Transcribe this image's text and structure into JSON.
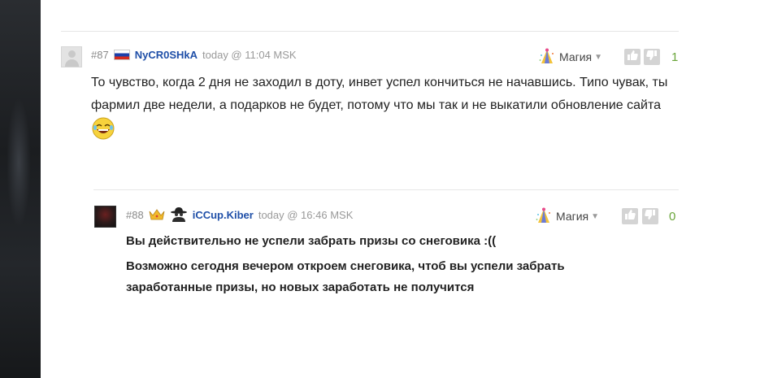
{
  "comments": [
    {
      "number": "#87",
      "username": "NyCR0SHkA",
      "time": "today @ 11:04 MSK",
      "badge_label": "Магия",
      "score": "1",
      "text": "То чувство, когда 2 дня не заходил в доту, инвет успел кончиться не начавшись. Типо чувак, ты фармил две недели, а подарков не будет, потому что мы так и не выкатили обновление сайта",
      "icons": [
        "russia-flag-icon",
        "laughing-emoji-icon",
        "party-hat-icon",
        "like-icon",
        "dislike-icon"
      ]
    },
    {
      "number": "#88",
      "username": "iCCup.Kiber",
      "time": "today @ 16:46 MSK",
      "badge_label": "Магия",
      "score": "0",
      "text_line1": "Вы действительно не успели забрать призы со снеговика :((",
      "text_line2": "Возможно сегодня вечером откроем снеговика, чтоб вы успели забрать заработанные призы, но новых заработать не получится",
      "icons": [
        "crown-icon",
        "spy-icon",
        "party-hat-icon",
        "like-icon",
        "dislike-icon"
      ]
    }
  ],
  "colors": {
    "username": "#1f4fa8",
    "score": "#6aa53a",
    "vote_button": "#d4d4d4"
  }
}
